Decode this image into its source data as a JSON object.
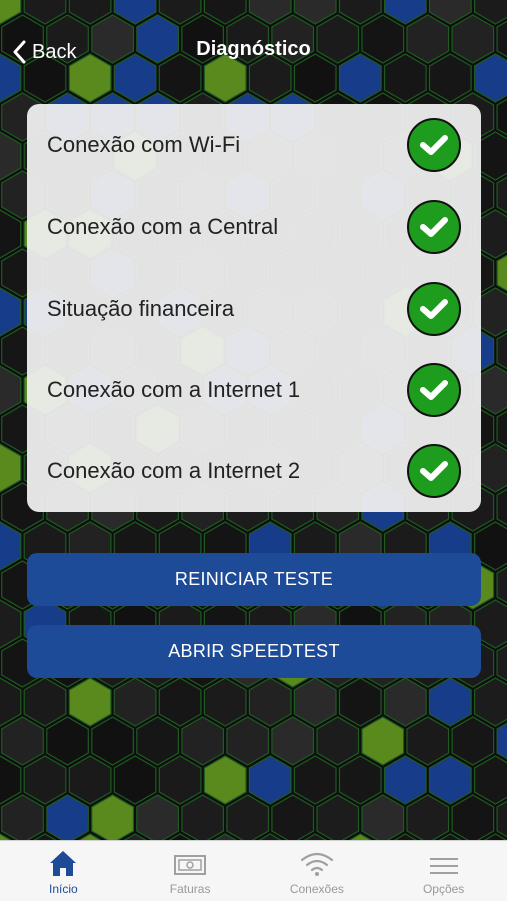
{
  "header": {
    "back_label": "Back",
    "title": "Diagnóstico"
  },
  "checks": [
    {
      "label": "Conexão com Wi-Fi",
      "status": "ok"
    },
    {
      "label": "Conexão com a Central",
      "status": "ok"
    },
    {
      "label": "Situação financeira",
      "status": "ok"
    },
    {
      "label": "Conexão com a Internet 1",
      "status": "ok"
    },
    {
      "label": "Conexão com a Internet 2",
      "status": "ok"
    }
  ],
  "actions": {
    "restart_label": "REINICIAR TESTE",
    "speedtest_label": "ABRIR SPEEDTEST"
  },
  "tabbar": {
    "items": [
      {
        "label": "Início",
        "icon": "home-icon",
        "active": true
      },
      {
        "label": "Faturas",
        "icon": "invoice-icon",
        "active": false
      },
      {
        "label": "Conexões",
        "icon": "wifi-icon",
        "active": false
      },
      {
        "label": "Opções",
        "icon": "menu-icon",
        "active": false
      }
    ]
  },
  "colors": {
    "accent": "#1d4b98",
    "success": "#1d9c1d",
    "hex_green": "#5a8a1e",
    "hex_blue": "#173c8a"
  }
}
